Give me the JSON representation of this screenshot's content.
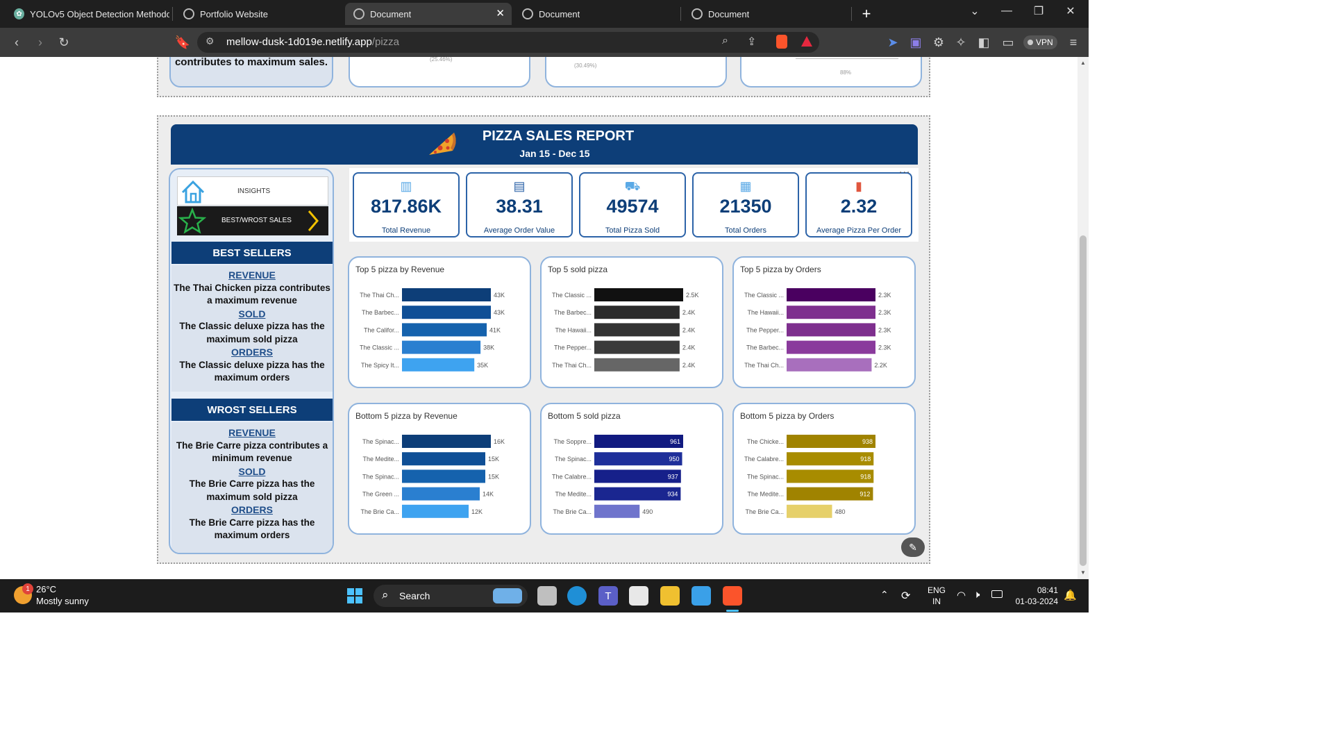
{
  "browser": {
    "tabs": [
      {
        "title": "YOLOv5 Object Detection Methodolo",
        "active": false
      },
      {
        "title": "Portfolio Website",
        "active": false
      },
      {
        "title": "Document",
        "active": true
      },
      {
        "title": "Document",
        "active": false
      },
      {
        "title": "Document",
        "active": false
      }
    ],
    "new_tab": "+",
    "url_host": "mellow-dusk-1d019e.netlify.app",
    "url_path": "/pizza",
    "vpn_label": "VPN"
  },
  "prev_report": {
    "text": "contributes to maximum sales.",
    "faint1": "(25.46%)",
    "faint2": "(30.49%)",
    "faint3": "88%"
  },
  "report": {
    "title": "PIZZA SALES REPORT",
    "date_range": "Jan 15 - Dec 15",
    "nav": {
      "insights": "INSIGHTS",
      "best_worst": "BEST/WROST SALES"
    },
    "best": {
      "heading": "BEST SELLERS",
      "revenue_label": "REVENUE",
      "revenue_text": "The Thai Chicken pizza contributes a maximum revenue",
      "sold_label": "SOLD",
      "sold_text": "The Classic deluxe pizza  has the maximum sold pizza",
      "orders_label": "ORDERS",
      "orders_text": "The Classic deluxe pizza  has the maximum orders"
    },
    "worst": {
      "heading": "WROST SELLERS",
      "revenue_label": "REVENUE",
      "revenue_text": "The Brie Carre pizza contributes a minimum revenue",
      "sold_label": "SOLD",
      "sold_text": "The Brie Carre pizza  has the maximum sold pizza",
      "orders_label": "ORDERS",
      "orders_text": "The Brie Carre pizza  has the maximum orders"
    },
    "kpis": [
      {
        "value": "817.86K",
        "label": "Total Revenue"
      },
      {
        "value": "38.31",
        "label": "Average Order Value"
      },
      {
        "value": "49574",
        "label": "Total Pizza Sold"
      },
      {
        "value": "21350",
        "label": "Total Orders"
      },
      {
        "value": "2.32",
        "label": "Average Pizza Per Order"
      }
    ],
    "more_menu": "..."
  },
  "chart_data": [
    {
      "type": "bar",
      "title": "Top 5 pizza by Revenue",
      "categories": [
        "The Thai Ch...",
        "The Barbec...",
        "The Califor...",
        "The Classic ...",
        "The Spicy It..."
      ],
      "values": [
        43,
        43,
        41,
        38,
        35
      ],
      "labels": [
        "43K",
        "43K",
        "41K",
        "38K",
        "35K"
      ],
      "colors": [
        "#0d3e78",
        "#0f4f96",
        "#1562ad",
        "#2a7fd0",
        "#3ea3f0"
      ],
      "label_inside": false
    },
    {
      "type": "bar",
      "title": "Top 5 sold pizza",
      "categories": [
        "The Classic ...",
        "The Barbec...",
        "The Hawaii...",
        "The Pepper...",
        "The Thai Ch..."
      ],
      "values": [
        2.5,
        2.4,
        2.4,
        2.4,
        2.4
      ],
      "labels": [
        "2.5K",
        "2.4K",
        "2.4K",
        "2.4K",
        "2.4K"
      ],
      "colors": [
        "#111111",
        "#2b2b2b",
        "#333333",
        "#3a3a3a",
        "#666666"
      ],
      "label_inside": false
    },
    {
      "type": "bar",
      "title": "Top 5 pizza by Orders",
      "categories": [
        "The Classic ...",
        "The Hawaii...",
        "The Pepper...",
        "The Barbec...",
        "The Thai Ch..."
      ],
      "values": [
        2.3,
        2.3,
        2.3,
        2.3,
        2.2
      ],
      "labels": [
        "2.3K",
        "2.3K",
        "2.3K",
        "2.3K",
        "2.2K"
      ],
      "colors": [
        "#4a0060",
        "#7e2f8e",
        "#7e2f8e",
        "#8a3a9c",
        "#a86fbd"
      ],
      "label_inside": false
    },
    {
      "type": "bar",
      "title": "Bottom 5 pizza by Revenue",
      "categories": [
        "The Spinac...",
        "The Medite...",
        "The Spinac...",
        "The Green ...",
        "The Brie Ca..."
      ],
      "values": [
        16,
        15,
        15,
        14,
        12
      ],
      "labels": [
        "16K",
        "15K",
        "15K",
        "14K",
        "12K"
      ],
      "colors": [
        "#0d3e78",
        "#0f4f96",
        "#1562ad",
        "#2a7fd0",
        "#3ea3f0"
      ],
      "label_inside": false
    },
    {
      "type": "bar",
      "title": "Bottom 5 sold pizza",
      "categories": [
        "The Soppre...",
        "The Spinac...",
        "The Calabre...",
        "The Medite...",
        "The Brie Ca..."
      ],
      "values": [
        961,
        950,
        937,
        934,
        490
      ],
      "labels": [
        "961",
        "950",
        "937",
        "934",
        "490"
      ],
      "colors": [
        "#111a80",
        "#1e2f9a",
        "#16208a",
        "#1a2690",
        "#6f74cc"
      ],
      "label_inside": true
    },
    {
      "type": "bar",
      "title": "Bottom 5 pizza by Orders",
      "categories": [
        "The Chicke...",
        "The Calabre...",
        "The Spinac...",
        "The Medite...",
        "The Brie Ca..."
      ],
      "values": [
        938,
        918,
        918,
        912,
        480
      ],
      "labels": [
        "938",
        "918",
        "918",
        "912",
        "480"
      ],
      "colors": [
        "#a08300",
        "#a88c00",
        "#a88c00",
        "#a08300",
        "#e6d06a"
      ],
      "label_inside": true
    }
  ],
  "taskbar": {
    "weather_temp": "26°C",
    "weather_desc": "Mostly sunny",
    "weather_badge": "1",
    "search_label": "Search",
    "lang1": "ENG",
    "lang2": "IN",
    "time": "08:41",
    "date": "01-03-2024"
  }
}
